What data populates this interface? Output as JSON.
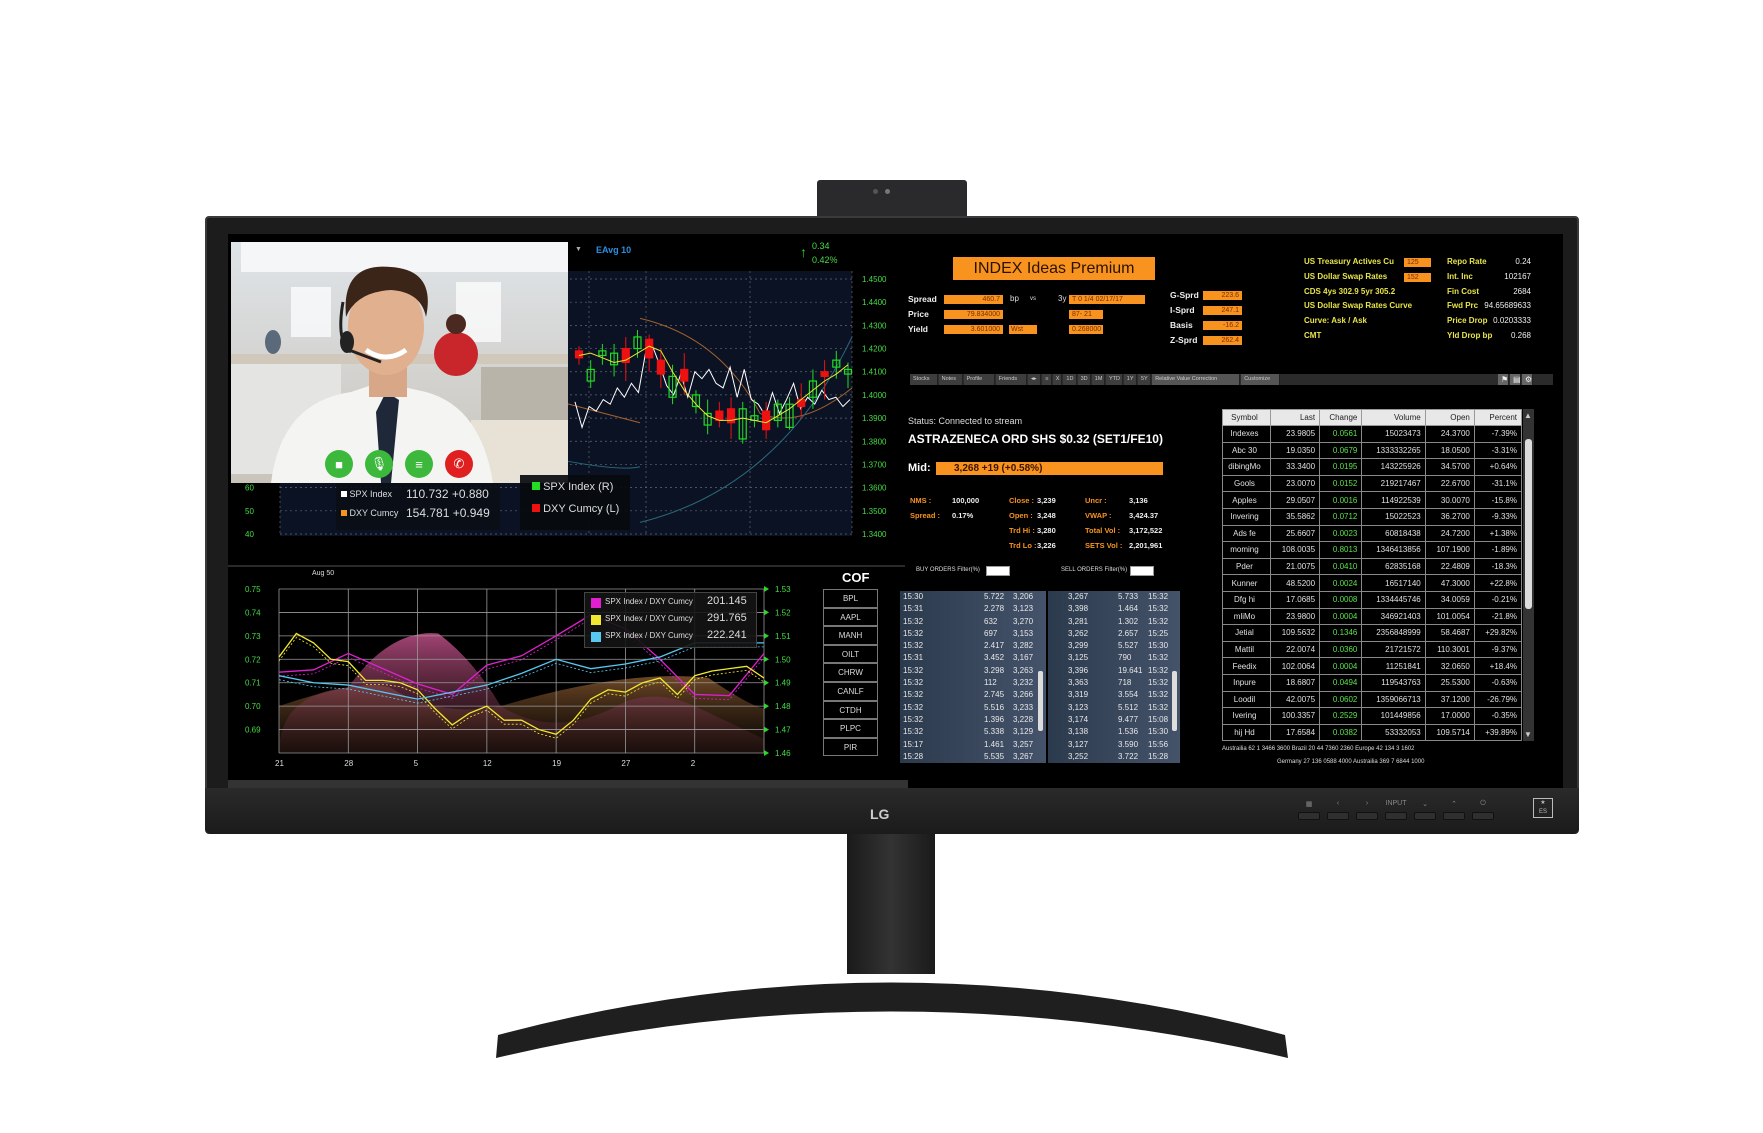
{
  "device": {
    "brand": "LG",
    "buttons": [
      "▦",
      "‹",
      "›",
      "INPUT",
      "⌄",
      "⌃",
      "⏻"
    ],
    "energy_label": "ENERGY STAR"
  },
  "video_call": {
    "buttons": [
      {
        "name": "camera",
        "icon": "video-camera-icon",
        "color": "#3cb83c",
        "glyph": "■"
      },
      {
        "name": "microphone",
        "icon": "microphone-icon",
        "color": "#3cb83c",
        "glyph": "🎙"
      },
      {
        "name": "menu",
        "icon": "list-icon",
        "color": "#3cb83c",
        "glyph": "≡"
      },
      {
        "name": "hang-up",
        "icon": "phone-icon",
        "color": "#e02020",
        "glyph": "✆"
      }
    ]
  },
  "top_chart": {
    "study_label": "EAvg 10",
    "change": "0.34",
    "change_pct": "0.42%",
    "legend_values": [
      {
        "name": "SPX Index",
        "value": "110.732 +0.880",
        "color": "#ffffff"
      },
      {
        "name": "DXY Cumcy",
        "value": "154.781 +0.949",
        "color": "#f7931e"
      }
    ],
    "legend_series": [
      {
        "name": "SPX Index (R)",
        "color": "#22dd22"
      },
      {
        "name": "DXY Cumcy (L)",
        "color": "#ee1111"
      }
    ]
  },
  "chart_data": [
    {
      "type": "candlestick",
      "right_axis": {
        "ticks": [
          "1.4500",
          "1.4400",
          "1.4300",
          "1.4200",
          "1.4100",
          "1.4000",
          "1.3900",
          "1.3800",
          "1.3700",
          "1.3600",
          "1.3500",
          "1.3400"
        ],
        "range": [
          1.34,
          1.45
        ]
      },
      "left_axis": {
        "ticks": [
          "60",
          "50",
          "40"
        ]
      },
      "grid": true,
      "candles": [
        [
          1.419,
          1.421,
          1.413,
          1.416
        ],
        [
          1.406,
          1.415,
          1.403,
          1.411
        ],
        [
          1.417,
          1.422,
          1.413,
          1.419
        ],
        [
          1.413,
          1.422,
          1.408,
          1.418
        ],
        [
          1.42,
          1.425,
          1.406,
          1.414
        ],
        [
          1.42,
          1.428,
          1.416,
          1.425
        ],
        [
          1.424,
          1.426,
          1.41,
          1.416
        ],
        [
          1.415,
          1.42,
          1.403,
          1.409
        ],
        [
          1.399,
          1.413,
          1.396,
          1.408
        ],
        [
          1.411,
          1.418,
          1.4,
          1.406
        ],
        [
          1.395,
          1.402,
          1.392,
          1.4
        ],
        [
          1.387,
          1.398,
          1.383,
          1.392
        ],
        [
          1.393,
          1.397,
          1.386,
          1.389
        ],
        [
          1.394,
          1.399,
          1.381,
          1.388
        ],
        [
          1.381,
          1.397,
          1.379,
          1.394
        ],
        [
          1.389,
          1.398,
          1.386,
          1.391
        ],
        [
          1.393,
          1.397,
          1.381,
          1.385
        ],
        [
          1.389,
          1.398,
          1.386,
          1.396
        ],
        [
          1.386,
          1.399,
          1.385,
          1.396
        ],
        [
          1.398,
          1.405,
          1.39,
          1.395
        ],
        [
          1.399,
          1.411,
          1.394,
          1.406
        ],
        [
          1.41,
          1.415,
          1.398,
          1.408
        ],
        [
          1.412,
          1.419,
          1.407,
          1.415
        ],
        [
          1.409,
          1.414,
          1.403,
          1.411
        ]
      ],
      "candle_ohlc_order": [
        "open",
        "high",
        "low",
        "close"
      ],
      "spx_line": [
        1.397,
        1.386,
        1.395,
        1.393,
        1.398,
        1.396,
        1.403,
        1.399,
        1.405,
        1.401,
        1.418,
        1.421,
        1.413,
        1.404,
        1.4,
        1.409,
        1.399,
        1.41,
        1.407,
        1.411,
        1.405,
        1.403,
        1.412,
        1.399,
        1.411,
        1.398,
        1.396,
        1.391,
        1.401,
        1.392,
        1.398,
        1.405,
        1.394,
        1.399,
        1.396,
        1.402,
        1.398,
        1.399,
        1.395,
        1.398
      ],
      "eavg_line": [
        1.417,
        1.418,
        1.416,
        1.414,
        1.415,
        1.418,
        1.421,
        1.419,
        1.41,
        1.402,
        1.396,
        1.391,
        1.389,
        1.389,
        1.39,
        1.389,
        1.388,
        1.391,
        1.394,
        1.398,
        1.402,
        1.406,
        1.409,
        1.413
      ]
    },
    {
      "type": "line",
      "title": "Aug 50",
      "x_ticks": [
        "21",
        "28",
        "5",
        "12",
        "19",
        "27",
        "2"
      ],
      "left_axis": {
        "ticks": [
          "0.75",
          "0.74",
          "0.73",
          "0.72",
          "0.71",
          "0.70",
          "0.69"
        ],
        "range": [
          0.68,
          0.75
        ]
      },
      "right_axis": {
        "ticks": [
          "1.53",
          "1.52",
          "1.51",
          "1.50",
          "1.49",
          "1.48",
          "1.47",
          "1.46"
        ],
        "range": [
          1.46,
          1.53
        ]
      },
      "grid": true,
      "legend_position": "top-right",
      "series": [
        {
          "name": "SPX Index / DXY Cumcy",
          "value": "201.145",
          "color": "#e020d0",
          "values": [
            0.7145,
            0.7155,
            0.7225,
            0.716,
            0.7095,
            0.705,
            0.7175,
            0.7215,
            0.73,
            0.739,
            0.733,
            0.72,
            0.705,
            0.7045,
            0.7225
          ]
        },
        {
          "name": "SPX Index / DXY Cumcy",
          "value": "291.765",
          "color": "#f2e830",
          "values": [
            0.721,
            0.731,
            0.727,
            0.72,
            0.719,
            0.711,
            0.711,
            0.71,
            0.707,
            0.699,
            0.692,
            0.697,
            0.7,
            0.694,
            0.694,
            0.69,
            0.688,
            0.694,
            0.703,
            0.707,
            0.706,
            0.71,
            0.712,
            0.705,
            0.713,
            0.715,
            0.716,
            0.717,
            0.712
          ]
        },
        {
          "name": "SPX Index / DXY Cumcy",
          "value": "222.241",
          "color": "#58c8f0",
          "values": [
            0.713,
            0.71,
            0.709,
            0.706,
            0.703,
            0.706,
            0.709,
            0.714,
            0.72,
            0.716,
            0.718,
            0.721,
            0.727,
            0.727,
            0.727
          ]
        }
      ]
    }
  ],
  "watchlist": {
    "title": "COF",
    "items": [
      "BPL",
      "AAPL",
      "MANH",
      "OILT",
      "CHRW",
      "CANLF",
      "CTDH",
      "PLPC",
      "PIR"
    ]
  },
  "ideas": {
    "title": "INDEX  Ideas Premium",
    "spread": {
      "label": "Spread",
      "value": "460.7",
      "unit": "bp",
      "vs": "vs",
      "tenor": "3y",
      "bench": "T  0  1/4     02/17/17"
    },
    "price": {
      "label": "Price",
      "value": "79.834000",
      "bench": "87- 21"
    },
    "yield": {
      "label": "Yield",
      "value": "3.601000",
      "type": "Wst",
      "bench": "0.268000"
    },
    "spreads": [
      {
        "label": "G-Sprd",
        "value": "223.6"
      },
      {
        "label": "I-Sprd",
        "value": "247.1"
      },
      {
        "label": "Basis",
        "value": "-16.2"
      },
      {
        "label": "Z-Sprd",
        "value": "262.4"
      }
    ],
    "curves": [
      "US Treasury Actives Cu",
      "US Dollar Swap Rates",
      "CDS 4ys 302.9     5yr 305.2",
      "US Dollar Swap Rates Curve",
      "Curve: Ask / Ask",
      "CMT"
    ],
    "curve_fields": [
      "125",
      "152"
    ],
    "metrics": [
      {
        "label": "Repo Rate",
        "value": "0.24"
      },
      {
        "label": "Int. Inc",
        "value": "102167"
      },
      {
        "label": "Fin Cost",
        "value": "2684"
      },
      {
        "label": "Fwd Prc",
        "value": "94.65689633"
      },
      {
        "label": "Price Drop",
        "value": "0.0203333"
      },
      {
        "label": "Yld Drop bp",
        "value": "0.268"
      }
    ]
  },
  "toolbar": {
    "tabs": [
      "Stocks",
      "Notes",
      "Profile",
      "Friends",
      "◂▸",
      "≡",
      "X",
      "1D",
      "3D",
      "1M",
      "YTD",
      "1Y",
      "5Y",
      "Relative Value Correction",
      "Customize"
    ],
    "icons": [
      "flag-icon",
      "document-icon",
      "gear-icon"
    ]
  },
  "quote": {
    "status": "Status: Connected to stream",
    "name": "ASTRAZENECA ORD SHS $0.32 (SET1/FE10)",
    "mid_label": "Mid:",
    "mid_value": "3,268   +19  (+0.58%)",
    "stats": [
      [
        {
          "label": "NMS :",
          "value": "100,000"
        },
        {
          "label": "Close :",
          "value": "3,239"
        },
        {
          "label": "Uncr :",
          "value": "3,136"
        }
      ],
      [
        {
          "label": "Spread :",
          "value": "0.17%"
        },
        {
          "label": "Open :",
          "value": "3,248"
        },
        {
          "label": "VWAP :",
          "value": "3,424.37"
        }
      ],
      [
        {
          "label": "",
          "value": ""
        },
        {
          "label": "Trd Hi :",
          "value": "3,280"
        },
        {
          "label": "Total Vol :",
          "value": "3,172,522"
        }
      ],
      [
        {
          "label": "",
          "value": ""
        },
        {
          "label": "Trd Lo :",
          "value": "3,226"
        },
        {
          "label": "SETS Vol :",
          "value": "2,201,961"
        }
      ]
    ],
    "buy_filter_label": "BUY ORDERS Filter(%)",
    "sell_filter_label": "SELL ORDERS Filter(%)",
    "buy_orders": [
      [
        "15:30",
        "5.722",
        "3,206"
      ],
      [
        "15:31",
        "2.278",
        "3,123"
      ],
      [
        "15:32",
        "632",
        "3,270"
      ],
      [
        "15:32",
        "697",
        "3,153"
      ],
      [
        "15:32",
        "2.417",
        "3,282"
      ],
      [
        "15:31",
        "3.452",
        "3,167"
      ],
      [
        "15:32",
        "3.298",
        "3,263"
      ],
      [
        "15:32",
        "112",
        "3,232"
      ],
      [
        "15:32",
        "2.745",
        "3,266"
      ],
      [
        "15:32",
        "5.516",
        "3,233"
      ],
      [
        "15:32",
        "1.396",
        "3,228"
      ],
      [
        "15:32",
        "5.338",
        "3,129"
      ],
      [
        "15:17",
        "1.461",
        "3,257"
      ],
      [
        "15:28",
        "5.535",
        "3,267"
      ]
    ],
    "sell_orders": [
      [
        "3,267",
        "5.733",
        "15:32"
      ],
      [
        "3,398",
        "1.464",
        "15:32"
      ],
      [
        "3,281",
        "1.302",
        "15:32"
      ],
      [
        "3,262",
        "2.657",
        "15:25"
      ],
      [
        "3,299",
        "5.527",
        "15:30"
      ],
      [
        "3,125",
        "790",
        "15:32"
      ],
      [
        "3,396",
        "19.641",
        "15:32"
      ],
      [
        "3,363",
        "718",
        "15:32"
      ],
      [
        "3,319",
        "3.554",
        "15:32"
      ],
      [
        "3,123",
        "5.512",
        "15:32"
      ],
      [
        "3,174",
        "9.477",
        "15:08"
      ],
      [
        "3,138",
        "1.536",
        "15:30"
      ],
      [
        "3,127",
        "3.590",
        "15:56"
      ],
      [
        "3,252",
        "3.722",
        "15:28"
      ]
    ]
  },
  "quotes_table": {
    "columns": [
      "Symbol",
      "Last",
      "Change",
      "Volume",
      "Open",
      "Percent"
    ],
    "rows": [
      [
        "Indexes",
        "23.9805",
        "0.0561",
        "15023473",
        "24.3700",
        "-7.39%"
      ],
      [
        "Abc 30",
        "19.0350",
        "0.0679",
        "1333332265",
        "18.0500",
        "-3.31%"
      ],
      [
        "dibingMo",
        "33.3400",
        "0.0195",
        "143225926",
        "34.5700",
        "+0.64%"
      ],
      [
        "Gools",
        "23.0070",
        "0.0152",
        "219217467",
        "22.6700",
        "-31.1%"
      ],
      [
        "Apples",
        "29.0507",
        "0.0016",
        "114922539",
        "30.0070",
        "-15.8%"
      ],
      [
        "Invering",
        "35.5862",
        "0.0712",
        "15022523",
        "36.2700",
        "-9.33%"
      ],
      [
        "Ads fe",
        "25.6607",
        "0.0023",
        "60818438",
        "24.7200",
        "+1.38%"
      ],
      [
        "moming",
        "108.0035",
        "0.8013",
        "1346413856",
        "107.1900",
        "-1.89%"
      ],
      [
        "Pder",
        "21.0075",
        "0.0410",
        "62835168",
        "22.4809",
        "-18.3%"
      ],
      [
        "Kunner",
        "48.5200",
        "0.0024",
        "16517140",
        "47.3000",
        "+22.8%"
      ],
      [
        "Dfg hi",
        "17.0685",
        "0.0008",
        "1334445746",
        "34.0059",
        "-0.21%"
      ],
      [
        "mliMo",
        "23.9800",
        "0.0004",
        "346921403",
        "101.0054",
        "-21.8%"
      ],
      [
        "Jetial",
        "109.5632",
        "0.1346",
        "2356848999",
        "58.4687",
        "+29.82%"
      ],
      [
        "Mattil",
        "22.0074",
        "0.0360",
        "21721572",
        "110.3001",
        "-9.37%"
      ],
      [
        "Feedix",
        "102.0064",
        "0.0004",
        "11251841",
        "32.0650",
        "+18.4%"
      ],
      [
        "Inpure",
        "18.6807",
        "0.0494",
        "119543763",
        "25.5300",
        "-0.63%"
      ],
      [
        "Loodil",
        "42.0075",
        "0.0602",
        "1359066713",
        "37.1200",
        "-26.79%"
      ],
      [
        "Ivering",
        "100.3357",
        "0.2529",
        "101449856",
        "17.0000",
        "-0.35%"
      ],
      [
        "hij Hd",
        "17.6584",
        "0.0382",
        "53332053",
        "109.5714",
        "+39.89%"
      ]
    ],
    "footer": [
      "Austrailia    62   1   3466   3600          Brazil    20   44   7360   2360          Europe    42   134   3   1602",
      "Germany    27   136   0588   4000          Austrailia    369   7   6844   1000"
    ]
  }
}
